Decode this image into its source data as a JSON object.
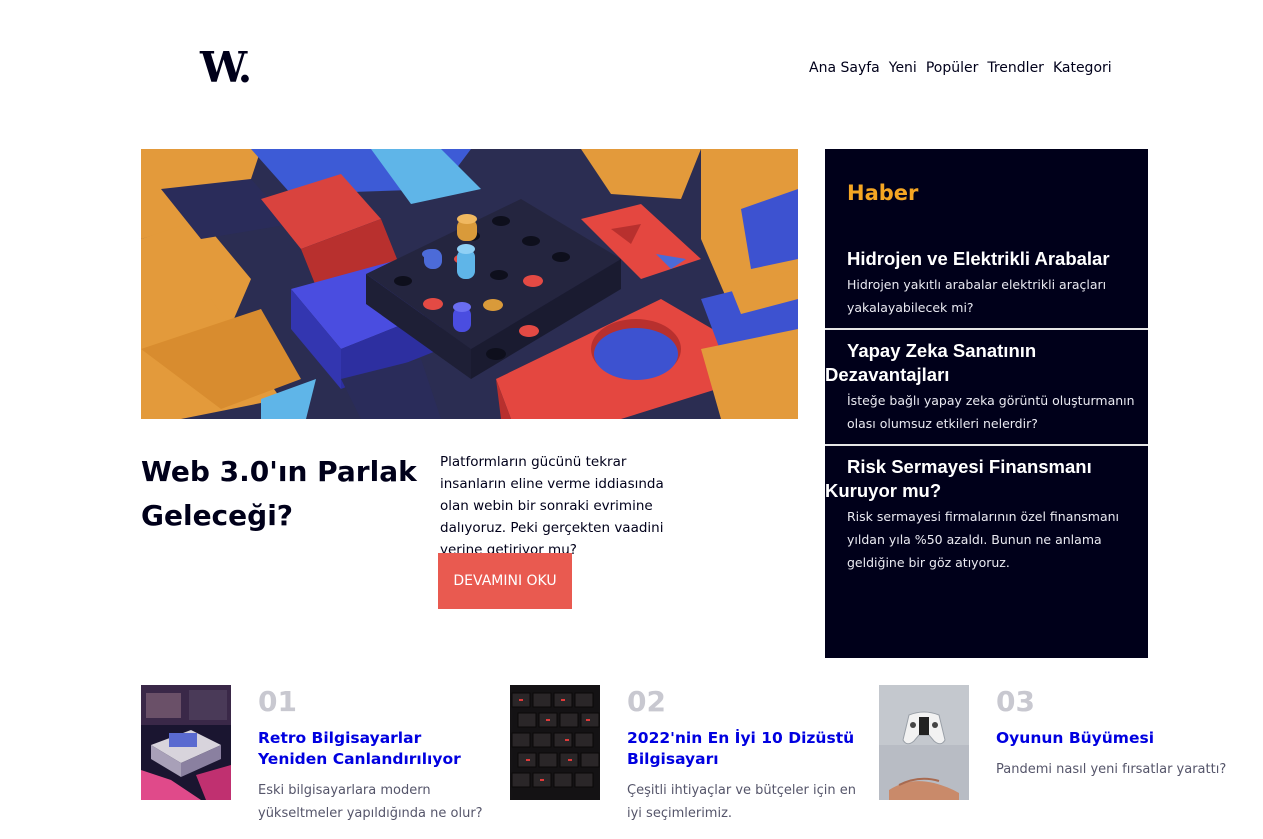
{
  "logo": {
    "text": "W."
  },
  "nav": {
    "items": [
      "Ana Sayfa",
      "Yeni",
      "Popüler",
      "Trendler",
      "Kategori"
    ]
  },
  "hero": {
    "title": "Web 3.0'ın Parlak Geleceği?",
    "description": "Platformların gücünü tekrar insanların eline verme iddiasında olan webin bir sonraki evrimine dalıyoruz. Peki gerçekten vaadini yerine getiriyor mu?",
    "button": "DEVAMINI OKU"
  },
  "news": {
    "heading": "Haber",
    "items": [
      {
        "title": "Hidrojen ve Elektrikli Arabalar",
        "text": "Hidrojen yakıtlı arabalar elektrikli araçları yakalayabilecek mi?"
      },
      {
        "title": "Yapay Zeka Sanatının Dezavantajları",
        "text": "İsteğe bağlı yapay zeka görüntü oluşturmanın olası olumsuz etkileri nelerdir?"
      },
      {
        "title": "Risk Sermayesi Finansmanı Kuruyor mu?",
        "text": "Risk sermayesi firmalarının özel finansmanı yıldan yıla %50 azaldı. Bunun ne anlama geldiğine bir göz atıyoruz."
      }
    ]
  },
  "cards": [
    {
      "number": "01",
      "title": "Retro Bilgisayarlar Yeniden Canlandırılıyor",
      "text": "Eski bilgisayarlara modern yükseltmeler yapıldığında ne olur?"
    },
    {
      "number": "02",
      "title": "2022'nin En İyi 10 Dizüstü Bilgisayarı",
      "text": "Çeşitli ihtiyaçlar ve bütçeler için en iyi seçimlerimiz."
    },
    {
      "number": "03",
      "title": "Oyunun Büyümesi",
      "text": "Pandemi nasıl yeni fırsatlar yarattı?"
    }
  ],
  "colors": {
    "navy": "#00001a",
    "accent_orange": "#f5a623",
    "button_red": "#e95a50",
    "link_blue": "#0000e0"
  }
}
